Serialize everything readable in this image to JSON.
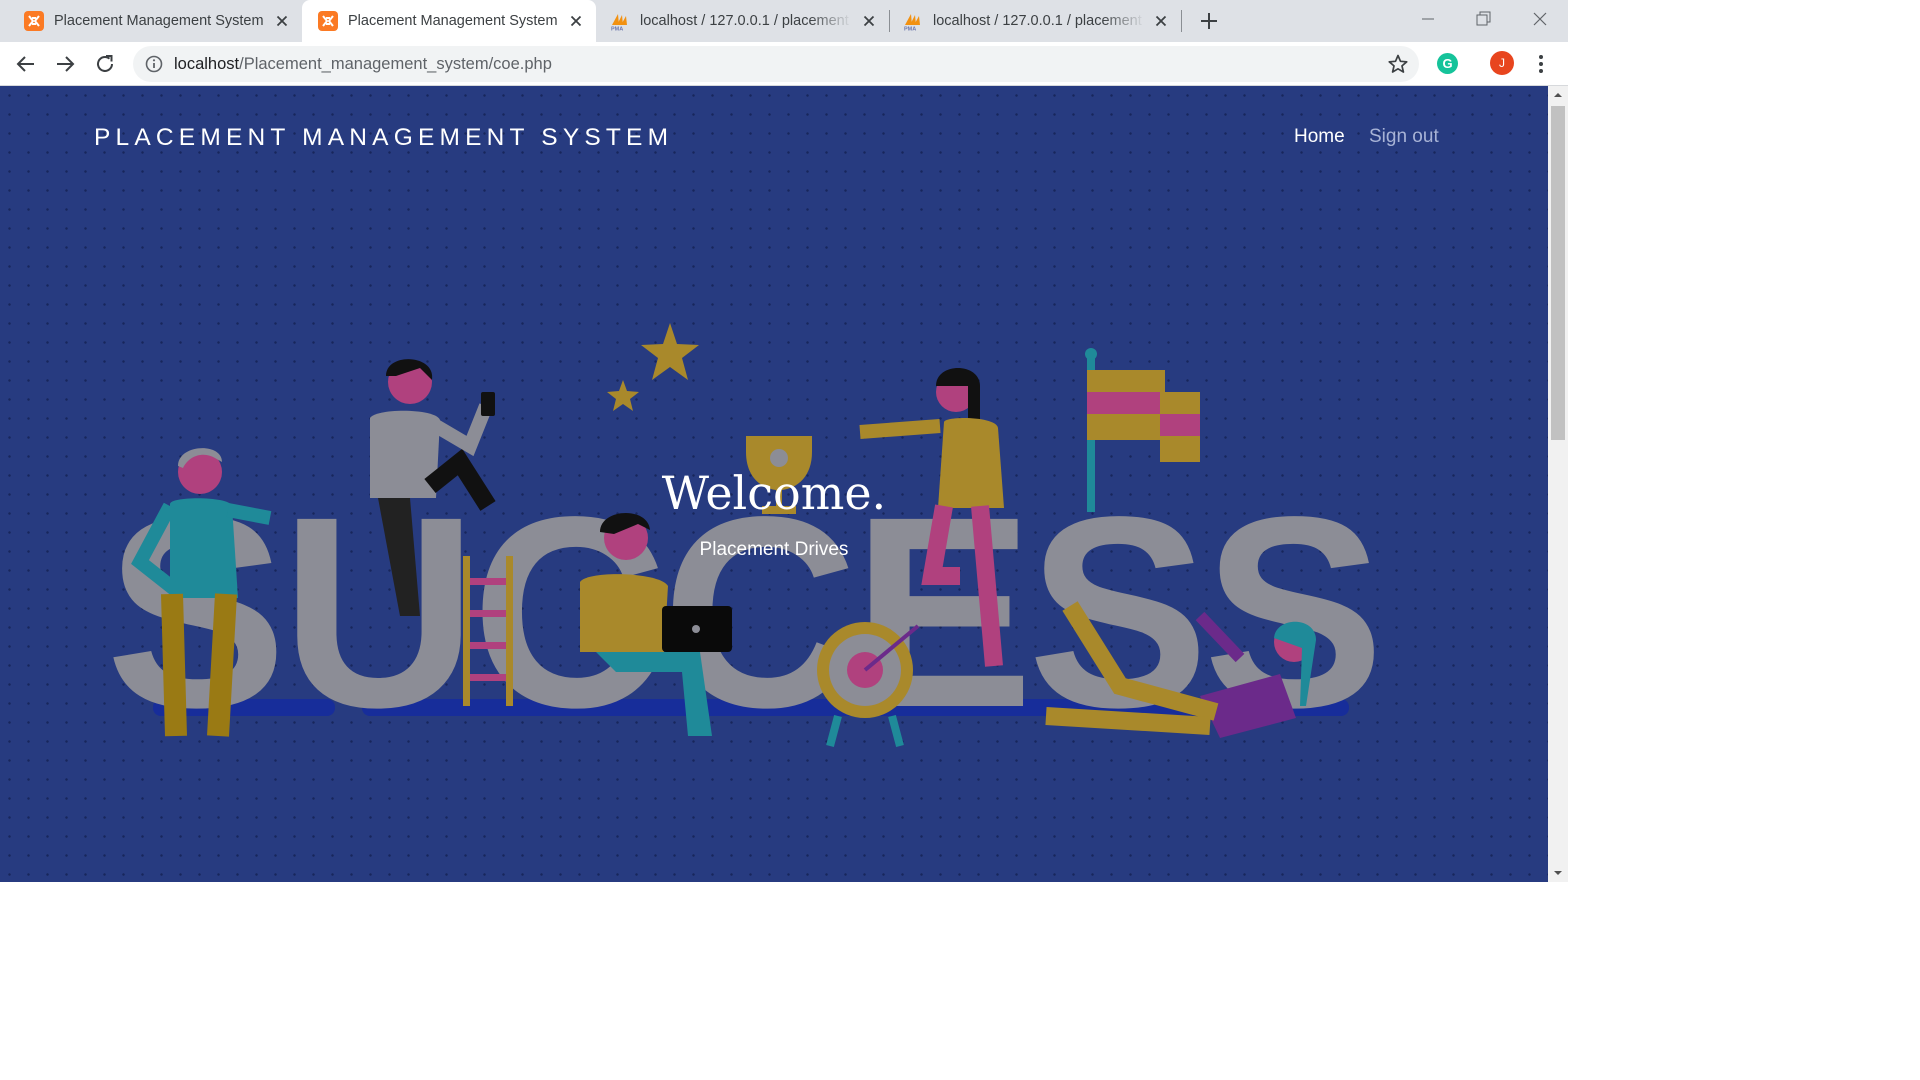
{
  "browser": {
    "tabs": [
      {
        "title": "Placement Management System",
        "favicon": "xampp-icon",
        "active": false
      },
      {
        "title": "Placement Management System",
        "favicon": "xampp-icon",
        "active": true
      },
      {
        "title": "localhost / 127.0.0.1 / placement",
        "favicon": "phpmyadmin-icon",
        "active": false
      },
      {
        "title": "localhost / 127.0.0.1 / placement",
        "favicon": "phpmyadmin-icon",
        "active": false
      }
    ],
    "address_bar": {
      "host": "localhost",
      "path": "/Placement_management_system/coe.php"
    },
    "profile_initial": "J",
    "extension_initial": "G",
    "colors": {
      "tab_strip": "#dee1e6",
      "avatar": "#e8451e",
      "extension": "#15c39a"
    }
  },
  "page": {
    "brand": "PLACEMENT MANAGEMENT SYSTEM",
    "nav": {
      "home": "Home",
      "sign_out": "Sign out"
    },
    "hero": {
      "title": "Welcome.",
      "subtitle": "Placement Drives",
      "illustration_word": "SUCCESS"
    },
    "colors": {
      "background": "#273b80",
      "nav_inactive": "#a8b3d6",
      "text": "#ffffff"
    }
  }
}
